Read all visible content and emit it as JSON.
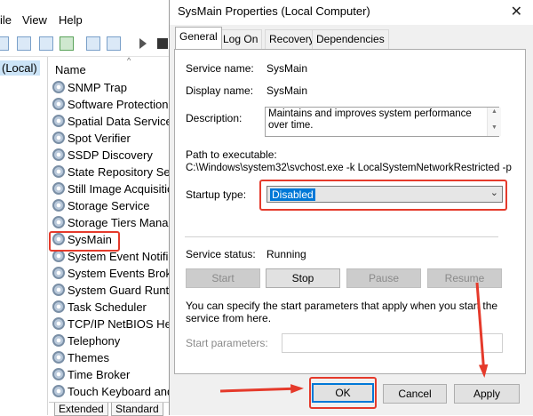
{
  "background": {
    "menu": [
      "ile",
      "View",
      "Help"
    ],
    "scope_label": "(Local)",
    "column_header": "Name",
    "services": [
      "SNMP Trap",
      "Software Protection",
      "Spatial Data Service",
      "Spot Verifier",
      "SSDP Discovery",
      "State Repository Serv",
      "Still Image Acquisitio",
      "Storage Service",
      "Storage Tiers Manag",
      "SysMain",
      "System Event Notifica",
      "System Events Broke",
      "System Guard Runtin",
      "Task Scheduler",
      "TCP/IP NetBIOS Help",
      "Telephony",
      "Themes",
      "Time Broker",
      "Touch Keyboard and"
    ],
    "bottom_tabs": [
      "Extended",
      "Standard"
    ]
  },
  "dialog": {
    "title": "SysMain Properties (Local Computer)",
    "close_glyph": "✕",
    "tabs": [
      "General",
      "Log On",
      "Recovery",
      "Dependencies"
    ],
    "service_name_label": "Service name:",
    "service_name": "SysMain",
    "display_name_label": "Display name:",
    "display_name": "SysMain",
    "description_label": "Description:",
    "description": "Maintains and improves system performance over time.",
    "path_label": "Path to executable:",
    "path": "C:\\Windows\\system32\\svchost.exe -k LocalSystemNetworkRestricted -p",
    "startup_label": "Startup type:",
    "startup_value": "Disabled",
    "status_label": "Service status:",
    "status_value": "Running",
    "buttons": {
      "start": "Start",
      "stop": "Stop",
      "pause": "Pause",
      "resume": "Resume"
    },
    "help_text": "You can specify the start parameters that apply when you start the service from here.",
    "params_label": "Start parameters:",
    "footer": {
      "ok": "OK",
      "cancel": "Cancel",
      "apply": "Apply"
    }
  },
  "annotation_color": "#e53a2b"
}
